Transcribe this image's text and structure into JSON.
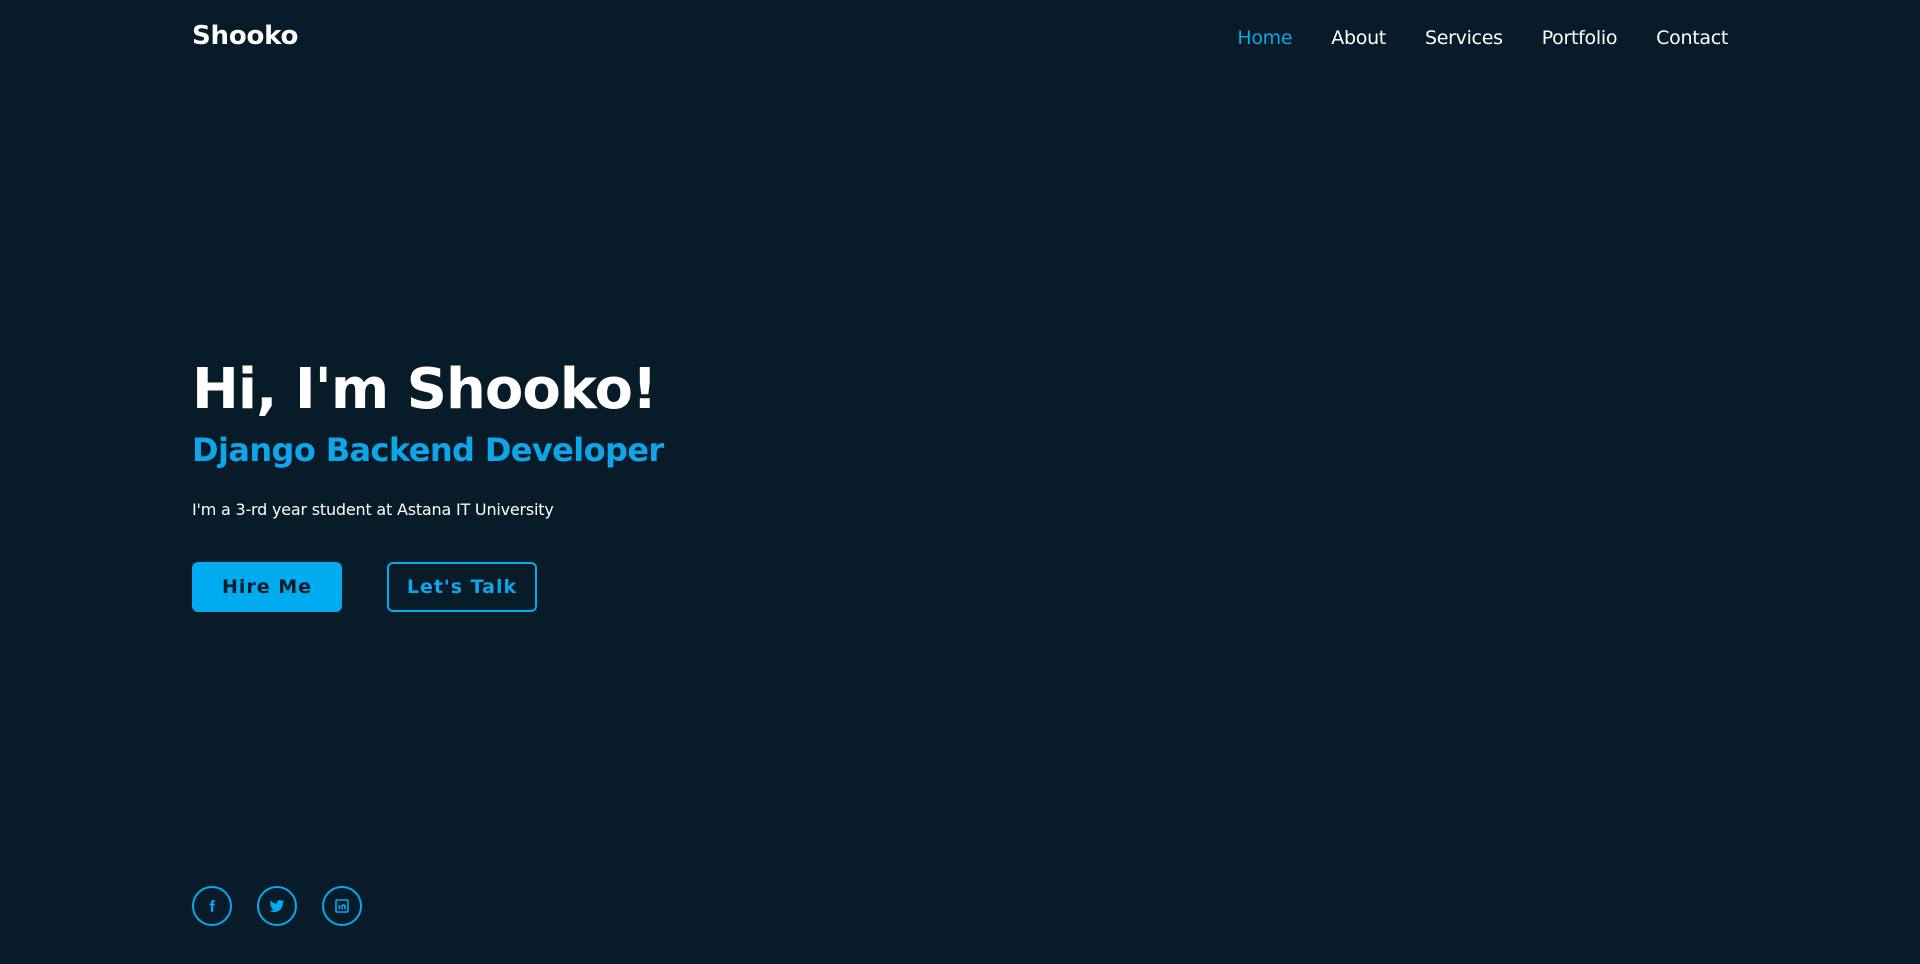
{
  "header": {
    "logo": "Shooko",
    "nav": [
      {
        "label": "Home",
        "active": true
      },
      {
        "label": "About",
        "active": false
      },
      {
        "label": "Services",
        "active": false
      },
      {
        "label": "Portfolio",
        "active": false
      },
      {
        "label": "Contact",
        "active": false
      }
    ]
  },
  "hero": {
    "title": "Hi, I'm Shooko!",
    "subtitle": "Django Backend Developer",
    "description": "I'm a 3-rd year student at Astana IT University",
    "buttons": {
      "primary": "Hire Me",
      "secondary": "Let's Talk"
    }
  },
  "social": [
    {
      "icon": "facebook-icon"
    },
    {
      "icon": "twitter-icon"
    },
    {
      "icon": "linkedin-icon"
    }
  ],
  "colors": {
    "background": "#081b29",
    "accent": "#00abf0",
    "text": "#ffffff"
  }
}
